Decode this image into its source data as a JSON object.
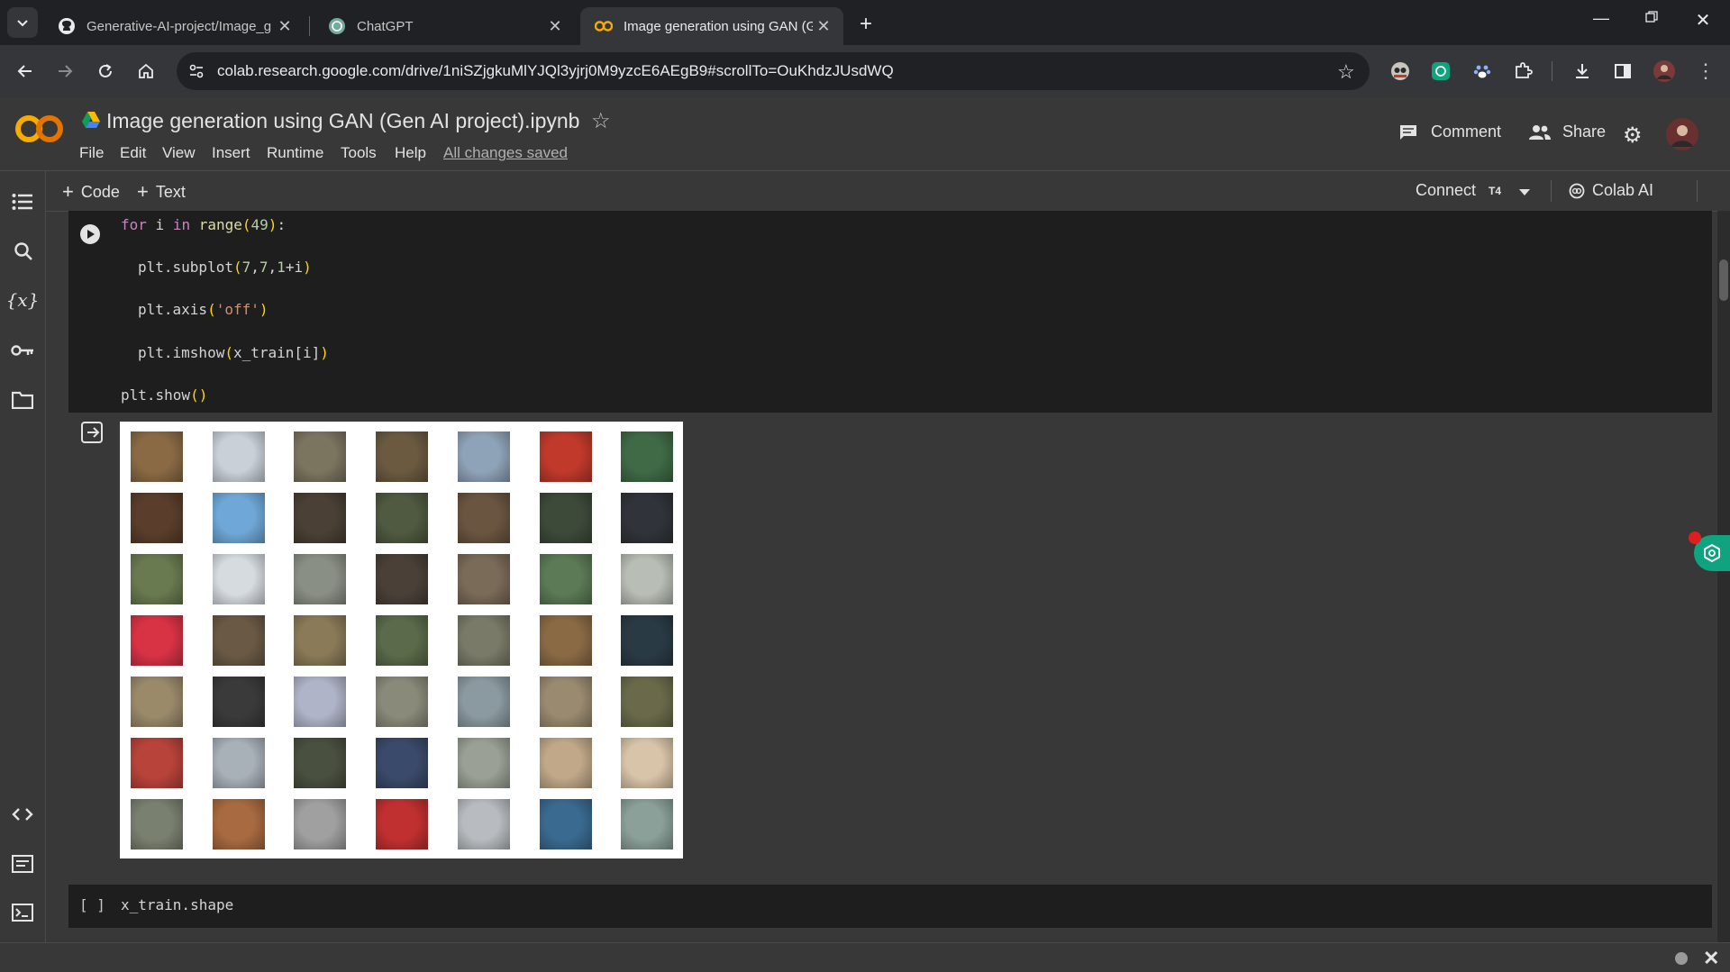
{
  "browser": {
    "tabs": [
      {
        "title": "Generative-AI-project/Image_g",
        "icon": "github-icon",
        "active": false
      },
      {
        "title": "ChatGPT",
        "icon": "chatgpt-icon",
        "active": false
      },
      {
        "title": "Image generation using GAN (G",
        "icon": "colab-icon",
        "active": true
      }
    ],
    "new_tab": "+",
    "url": "colab.research.google.com/drive/1niSZjgkuMlYJQl3yjrj0M9yzcE6AEgB9#scrollTo=OuKhdzJUsdWQ"
  },
  "colab": {
    "logo_text": "CO",
    "notebook_title": "Image generation using GAN (Gen AI project).ipynb",
    "menu": [
      "File",
      "Edit",
      "View",
      "Insert",
      "Runtime",
      "Tools",
      "Help"
    ],
    "save_status": "All changes saved",
    "comment_label": "Comment",
    "share_label": "Share",
    "add_code_label": "Code",
    "add_text_label": "Text",
    "connect_label": "Connect",
    "runtime_label": "T4",
    "colab_ai_label": "Colab AI"
  },
  "cell1": {
    "lines": [
      {
        "indent": 0,
        "parts": [
          {
            "t": "for",
            "c": "kw"
          },
          {
            "t": " i ",
            "c": ""
          },
          {
            "t": "in",
            "c": "kw"
          },
          {
            "t": " ",
            "c": ""
          },
          {
            "t": "range",
            "c": "bi"
          },
          {
            "t": "(",
            "c": "br"
          },
          {
            "t": "49",
            "c": "num"
          },
          {
            "t": ")",
            "c": "br"
          },
          {
            "t": ":",
            "c": ""
          }
        ]
      },
      {
        "indent": 1,
        "parts": [
          {
            "t": "plt.subplot",
            "c": ""
          },
          {
            "t": "(",
            "c": "br"
          },
          {
            "t": "7",
            "c": "num"
          },
          {
            "t": ",",
            "c": ""
          },
          {
            "t": "7",
            "c": "num"
          },
          {
            "t": ",",
            "c": ""
          },
          {
            "t": "1",
            "c": "num"
          },
          {
            "t": "+i",
            "c": ""
          },
          {
            "t": ")",
            "c": "br"
          }
        ]
      },
      {
        "indent": 1,
        "parts": [
          {
            "t": "plt.axis",
            "c": ""
          },
          {
            "t": "(",
            "c": "br"
          },
          {
            "t": "'off'",
            "c": "str"
          },
          {
            "t": ")",
            "c": "br"
          }
        ]
      },
      {
        "indent": 1,
        "parts": [
          {
            "t": "plt.imshow",
            "c": ""
          },
          {
            "t": "(",
            "c": "br"
          },
          {
            "t": "x_train[i]",
            "c": ""
          },
          {
            "t": ")",
            "c": "br"
          }
        ]
      },
      {
        "indent": 0,
        "parts": [
          {
            "t": "plt.show",
            "c": ""
          },
          {
            "t": "()",
            "c": "br"
          }
        ]
      }
    ]
  },
  "output": {
    "grid_rows": 7,
    "grid_cols": 7,
    "thumb_colors": [
      "#8a6a45",
      "#c9d0d8",
      "#7b7560",
      "#6b5a40",
      "#8fa3b8",
      "#c0392b",
      "#3f6a45",
      "#5a3e2b",
      "#6fa8d8",
      "#4a4035",
      "#4f5a40",
      "#6a5540",
      "#3d4a3a",
      "#30343a",
      "#6a7a50",
      "#d6dbe0",
      "#8a8f86",
      "#4a4038",
      "#7a6a58",
      "#5b7a55",
      "#b8bdb5",
      "#d83245",
      "#6a5a45",
      "#8a7a58",
      "#5a6a4a",
      "#7a7a68",
      "#8a6a45",
      "#2a3a45",
      "#9a8a6a",
      "#3a3a3a",
      "#b0b4c8",
      "#8a8a7a",
      "#8a9aa0",
      "#9a8a70",
      "#6a6a4a",
      "#b8433a",
      "#a8b0b8",
      "#4a5040",
      "#3a4a6a",
      "#9aa095",
      "#c0a888",
      "#d8c4a8",
      "#7a8070",
      "#a86a40",
      "#a0a0a0",
      "#c03030",
      "#b8bcc0",
      "#3a6a90",
      "#8aa098"
    ]
  },
  "cell2": {
    "bracket": "[ ]",
    "code": "x_train.shape"
  },
  "colors": {
    "accent_orange": "#f9ab00",
    "bg": "#383838",
    "code_bg": "#1e1e1e"
  }
}
